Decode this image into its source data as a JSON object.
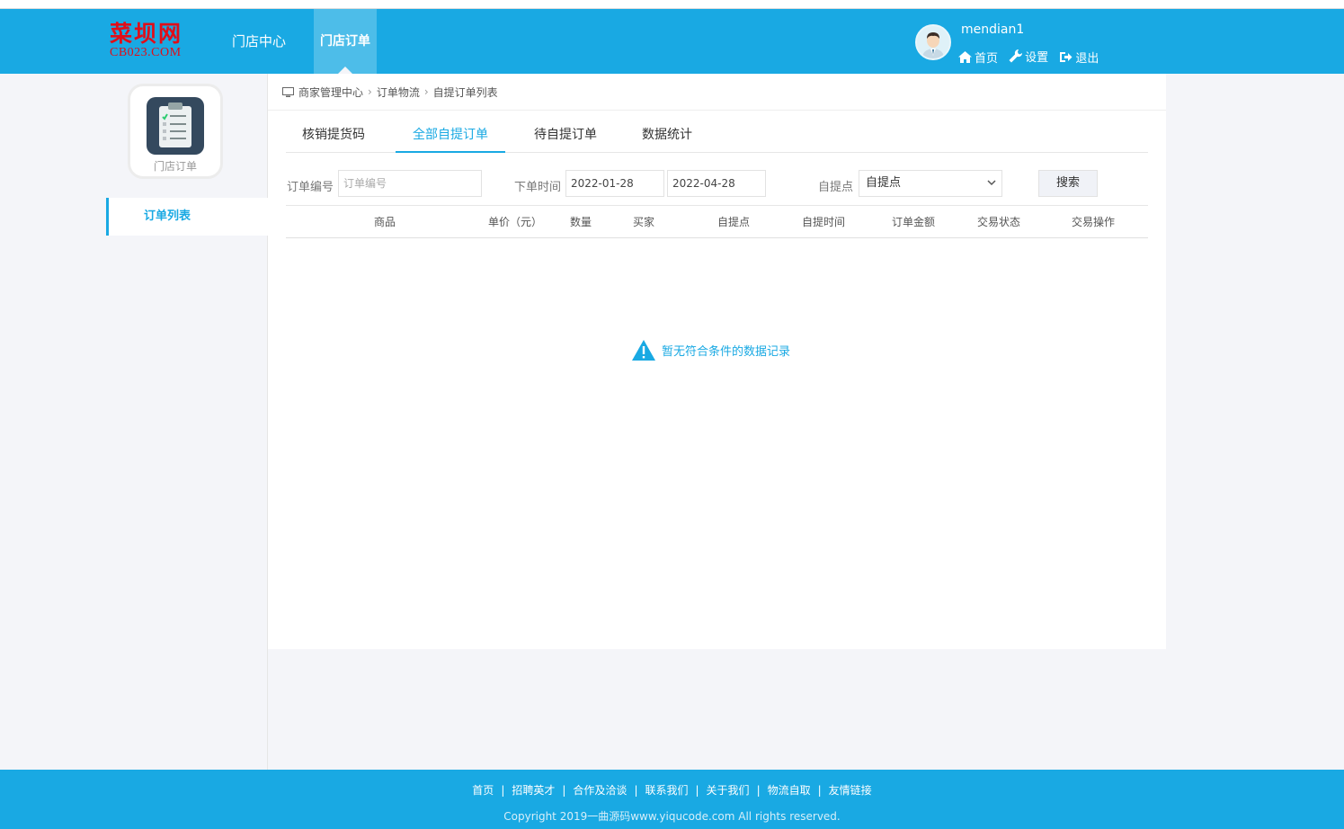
{
  "header": {
    "logo_cn": "菜坝网",
    "logo_en": "CB023.COM",
    "nav": [
      "门店中心",
      "门店订单"
    ],
    "username": "mendian1",
    "links": [
      "首页",
      "设置",
      "退出"
    ]
  },
  "sidebar": {
    "app_label": "门店订单",
    "menu": [
      "订单列表"
    ]
  },
  "breadcrumb": [
    "商家管理中心",
    "订单物流",
    "自提订单列表"
  ],
  "tabs": [
    "核销提货码",
    "全部自提订单",
    "待自提订单",
    "数据统计"
  ],
  "filters": {
    "order_no_label": "订单编号",
    "order_no_placeholder": "订单编号",
    "date_label": "下单时间",
    "date_from": "2022-01-28",
    "date_to": "2022-04-28",
    "pickup_label": "自提点",
    "pickup_value": "自提点",
    "search_label": "搜索"
  },
  "table": {
    "columns": [
      "商品",
      "单价（元）",
      "数量",
      "买家",
      "自提点",
      "自提时间",
      "订单金额",
      "交易状态",
      "交易操作"
    ],
    "empty_message": "暂无符合条件的数据记录"
  },
  "footer": {
    "links": [
      "首页",
      "招聘英才",
      "合作及洽谈",
      "联系我们",
      "关于我们",
      "物流自取",
      "友情链接"
    ],
    "copyright": "Copyright 2019一曲源码www.yiqucode.com All rights reserved."
  },
  "colors": {
    "brand_blue": "#19a9e3",
    "logo_red": "#e10d18"
  }
}
